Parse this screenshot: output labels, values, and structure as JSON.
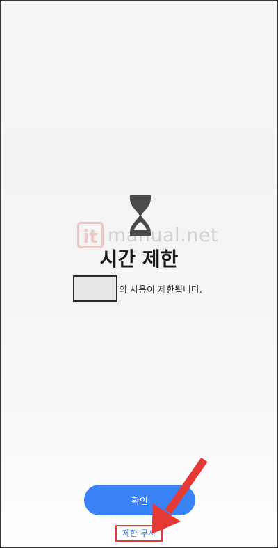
{
  "watermark": {
    "logo_text": "it",
    "site_text": "manual.net"
  },
  "screen": {
    "icon": "hourglass-icon",
    "title": "시간 제한",
    "description": "의 사용이 제한됩니다."
  },
  "buttons": {
    "confirm_label": "확인",
    "ignore_limit_label": "제한 무시"
  },
  "colors": {
    "accent": "#3b82f6",
    "annotation": "#e53935"
  }
}
